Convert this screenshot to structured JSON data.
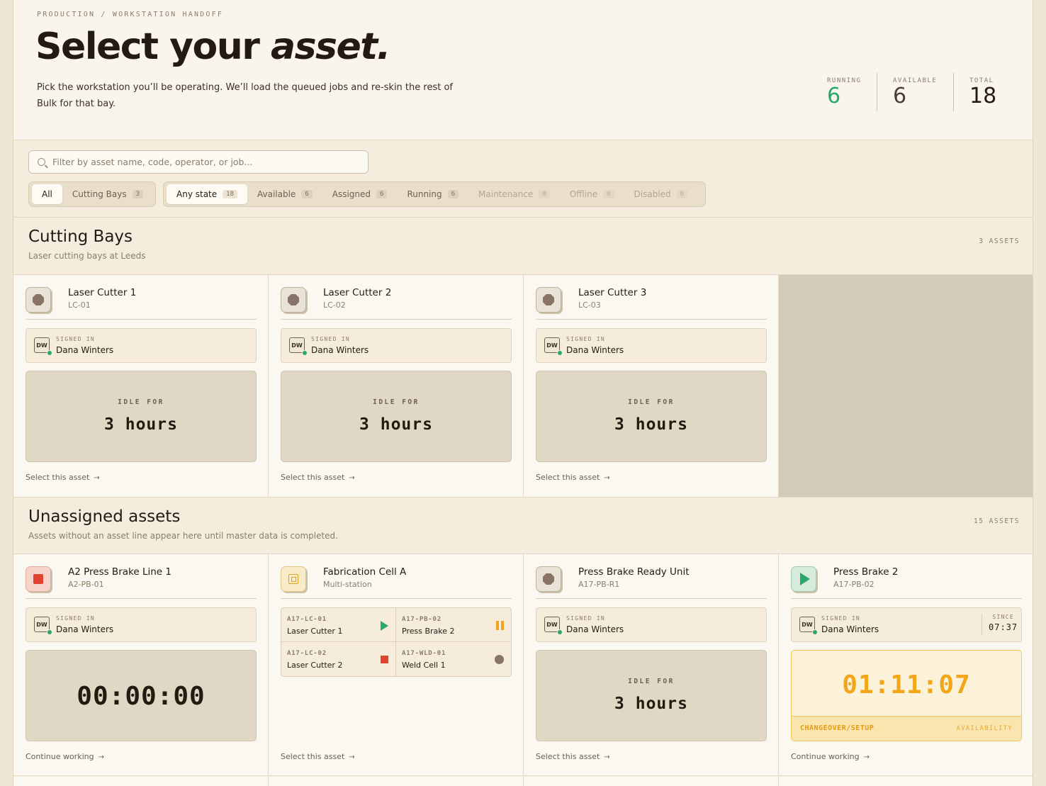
{
  "header": {
    "breadcrumb": "PRODUCTION / WORKSTATION HANDOFF",
    "title_plain": "Select your ",
    "title_italic": "asset.",
    "description": "Pick the workstation you’ll be operating. We’ll load the queued jobs and re-skin the rest of Bulk for that bay.",
    "stats": [
      {
        "label": "RUNNING",
        "value": "6",
        "color": "#2aa86b"
      },
      {
        "label": "AVAILABLE",
        "value": "6",
        "color": "#4a3f34"
      },
      {
        "label": "TOTAL",
        "value": "18",
        "color": "#241a12"
      }
    ]
  },
  "filters": {
    "search_placeholder": "Filter by asset name, code, operator, or job...",
    "search_icon": "search-icon",
    "groups": [
      {
        "chips": [
          {
            "label": "All",
            "count": "",
            "active": true
          },
          {
            "label": "Cutting Bays",
            "count": "3",
            "active": false
          }
        ]
      },
      {
        "chips": [
          {
            "label": "Any state",
            "count": "18",
            "active": true
          },
          {
            "label": "Available",
            "count": "6"
          },
          {
            "label": "Assigned",
            "count": "6"
          },
          {
            "label": "Running",
            "count": "6"
          },
          {
            "label": "Maintenance",
            "count": "0",
            "disabled": true
          },
          {
            "label": "Offline",
            "count": "0",
            "disabled": true
          },
          {
            "label": "Disabled",
            "count": "0",
            "disabled": true
          }
        ]
      }
    ]
  },
  "sections": [
    {
      "title": "Cutting Bays",
      "subtitle": "Laser cutting bays at Leeds",
      "count": "3 ASSETS",
      "cards": [
        {
          "name": "Laser Cutter 1",
          "code": "LC-01",
          "icon": "stop-octagon-icon",
          "signed_label": "SIGNED IN",
          "operator": "Dana Winters",
          "initials": "DW",
          "idle_label": "IDLE FOR",
          "idle_value": "3 hours",
          "action": "Select this asset"
        },
        {
          "name": "Laser Cutter 2",
          "code": "LC-02",
          "icon": "stop-octagon-icon",
          "signed_label": "SIGNED IN",
          "operator": "Dana Winters",
          "initials": "DW",
          "idle_label": "IDLE FOR",
          "idle_value": "3 hours",
          "action": "Select this asset"
        },
        {
          "name": "Laser Cutter 3",
          "code": "LC-03",
          "icon": "stop-octagon-icon",
          "signed_label": "SIGNED IN",
          "operator": "Dana Winters",
          "initials": "DW",
          "idle_label": "IDLE FOR",
          "idle_value": "3 hours",
          "action": "Select this asset"
        }
      ]
    },
    {
      "title": "Unassigned assets",
      "subtitle": "Assets without an asset line appear here until master data is completed.",
      "count": "15 ASSETS",
      "cards": [
        {
          "name": "A2 Press Brake Line 1",
          "code": "A2-PB-01",
          "icon": "stopped-square-icon",
          "signed_label": "SIGNED IN",
          "operator": "Dana Winters",
          "initials": "DW",
          "timer": "00:00:00",
          "action": "Continue working"
        },
        {
          "name": "Fabrication Cell A",
          "code": "Multi-station",
          "icon": "cpu-chip-icon",
          "stations": [
            {
              "code": "A17-LC-01",
              "name": "Laser Cutter 1",
              "state": "running"
            },
            {
              "code": "A17-PB-02",
              "name": "Press Brake 2",
              "state": "paused"
            },
            {
              "code": "A17-LC-02",
              "name": "Laser Cutter 2",
              "state": "stopped"
            },
            {
              "code": "A17-WLD-01",
              "name": "Weld Cell 1",
              "state": "idle"
            }
          ],
          "action": "Select this asset"
        },
        {
          "name": "Press Brake Ready Unit",
          "code": "A17-PB-R1",
          "icon": "stop-octagon-icon",
          "signed_label": "SIGNED IN",
          "operator": "Dana Winters",
          "initials": "DW",
          "idle_label": "IDLE FOR",
          "idle_value": "3 hours",
          "action": "Select this asset"
        },
        {
          "name": "Press Brake 2",
          "code": "A17-PB-02",
          "icon": "play-icon",
          "signed_label": "SIGNED IN",
          "operator": "Dana Winters",
          "initials": "DW",
          "since_label": "SINCE",
          "since_value": "07:37",
          "timer": "01:11:07",
          "reason": "CHANGEOVER/SETUP",
          "reason_category": "AVAILABILITY",
          "action": "Continue working"
        }
      ]
    }
  ],
  "colors": {
    "running": "#2aa86b",
    "paused": "#f2a71b",
    "stopped": "#e0432e",
    "idle": "#8a7468"
  }
}
